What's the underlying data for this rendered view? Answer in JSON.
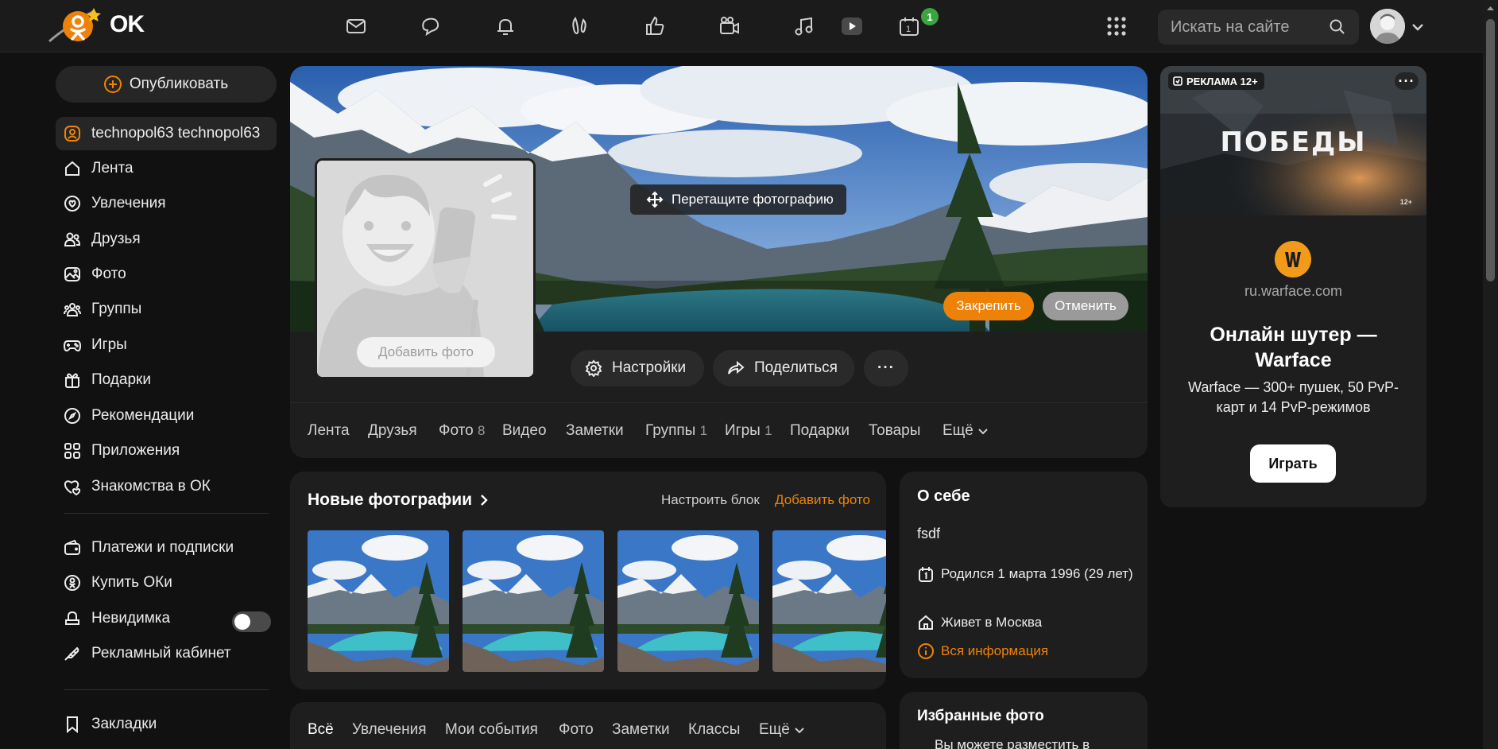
{
  "header": {
    "logo_text": "OK",
    "search_placeholder": "Искать на сайте",
    "notification_badge": "1",
    "nav_icons": [
      "mail-icon",
      "chat-icon",
      "bell-icon",
      "guests-icon",
      "like-icon",
      "video-call-icon",
      "music-icon",
      "video-play-icon",
      "calendar-icon"
    ]
  },
  "sidebar": {
    "publish_label": "Опубликовать",
    "items": [
      {
        "label": "technopol63 technopol63",
        "icon": "user-circle-icon",
        "active": true
      },
      {
        "label": "Лента",
        "icon": "home-icon"
      },
      {
        "label": "Увлечения",
        "icon": "hobby-icon"
      },
      {
        "label": "Друзья",
        "icon": "friends-icon"
      },
      {
        "label": "Фото",
        "icon": "photo-icon"
      },
      {
        "label": "Группы",
        "icon": "groups-icon"
      },
      {
        "label": "Игры",
        "icon": "gamepad-icon"
      },
      {
        "label": "Подарки",
        "icon": "gift-icon"
      },
      {
        "label": "Рекомендации",
        "icon": "compass-icon"
      },
      {
        "label": "Приложения",
        "icon": "apps-icon"
      },
      {
        "label": "Знакомства в ОК",
        "icon": "hearts-icon"
      }
    ],
    "items2": [
      {
        "label": "Платежи и подписки",
        "icon": "wallet-icon"
      },
      {
        "label": "Купить ОКи",
        "icon": "coin-icon"
      },
      {
        "label": "Невидимка",
        "icon": "invisible-icon",
        "toggle": false
      },
      {
        "label": "Рекламный кабинет",
        "icon": "megaphone-icon"
      }
    ],
    "items3": [
      {
        "label": "Закладки",
        "icon": "bookmark-icon"
      }
    ]
  },
  "profile": {
    "drag_hint": "Перетащите фотографию",
    "pin_label": "Закрепить",
    "cancel_label": "Отменить",
    "add_photo_label": "Добавить фото",
    "settings_label": "Настройки",
    "share_label": "Поделиться",
    "more_label": "···",
    "tabs": [
      {
        "label": "Лента",
        "count": ""
      },
      {
        "label": "Друзья",
        "count": ""
      },
      {
        "label": "Фото",
        "count": "8"
      },
      {
        "label": "Видео",
        "count": ""
      },
      {
        "label": "Заметки",
        "count": ""
      },
      {
        "label": "Группы",
        "count": "1"
      },
      {
        "label": "Игры",
        "count": "1"
      },
      {
        "label": "Подарки",
        "count": ""
      },
      {
        "label": "Товары",
        "count": ""
      },
      {
        "label": "Ещё",
        "count": ""
      }
    ]
  },
  "new_photos": {
    "title": "Новые фотографии",
    "configure_label": "Настроить блок",
    "add_label": "Добавить фото",
    "count_visible": 4
  },
  "feed_tabs": [
    "Всё",
    "Увлечения",
    "Мои события",
    "Фото",
    "Заметки",
    "Классы",
    "Ещё"
  ],
  "about": {
    "title": "О себе",
    "text": "fsdf",
    "birth": "Родился 1 марта 1996 (29 лет)",
    "city": "Живет в Москва",
    "all_info": "Вся информация"
  },
  "favorites": {
    "title": "Избранные фото",
    "text": "Вы можете разместить в"
  },
  "ad": {
    "label": "РЕКЛАМА 12+",
    "image_headline": "ПОБЕДЫ",
    "image_age": "12+",
    "domain": "ru.warface.com",
    "title": "Онлайн шутер — Warface",
    "description": "Warface — 300+ пушек, 50 PvP-карт и 14 PvP-режимов",
    "cta": "Играть"
  },
  "colors": {
    "accent": "#ee8208",
    "background": "#111111",
    "card": "#1e1e1e",
    "badge_green": "#3aa53f"
  }
}
